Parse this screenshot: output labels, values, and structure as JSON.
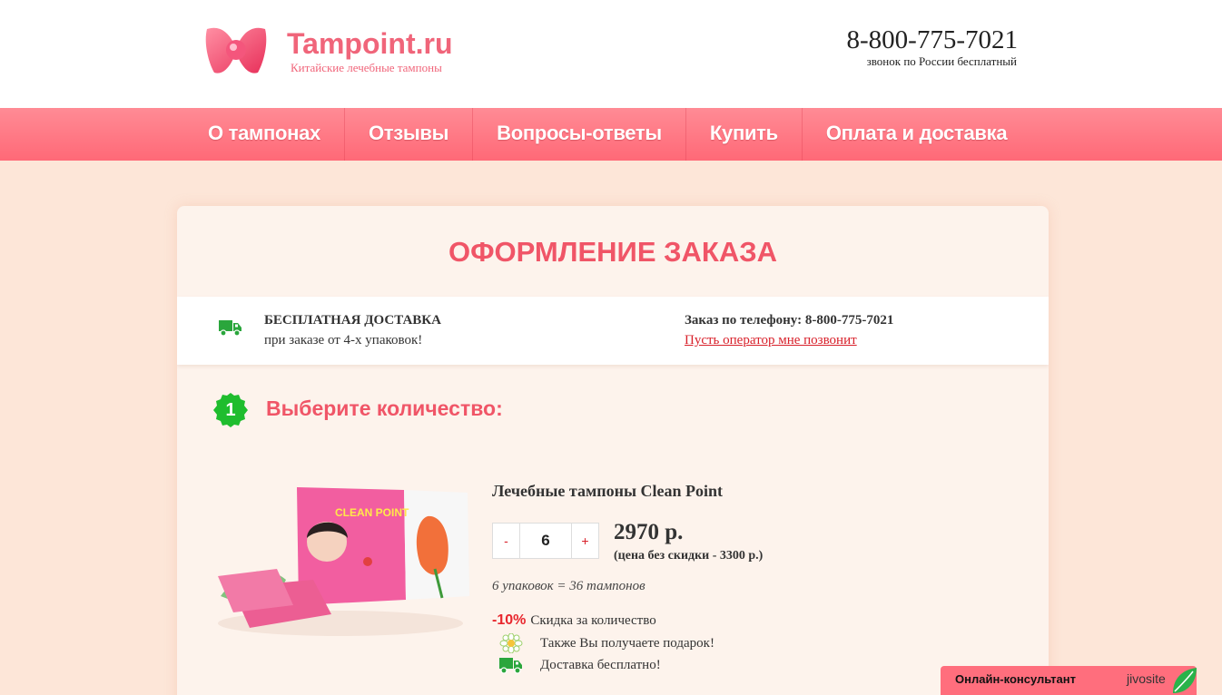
{
  "header": {
    "brand": "Tampoint.ru",
    "tagline": "Китайские лечебные тампоны",
    "phone": "8-800-775-7021",
    "phone_note": "звонок по России бесплатный"
  },
  "nav": {
    "items": [
      {
        "label": "О тампонах"
      },
      {
        "label": "Отзывы"
      },
      {
        "label": "Вопросы-ответы"
      },
      {
        "label": "Купить"
      },
      {
        "label": "Оплата и доставка"
      }
    ]
  },
  "order": {
    "title": "ОФОРМЛЕНИЕ ЗАКАЗА",
    "delivery_title": "БЕСПЛАТНАЯ ДОСТАВКА",
    "delivery_sub": "при заказе от 4-х упаковок!",
    "order_phone": "Заказ по телефону: 8-800-775-7021",
    "callback_link": "Пусть оператор мне позвонит",
    "step_number": "1",
    "step_title": "Выберите количество:",
    "product": {
      "name": "Лечебные тампоны Clean Point",
      "box_text": "CLEAN POINT",
      "minus_label": "-",
      "plus_label": "+",
      "quantity": "6",
      "price": "2970 р.",
      "price_old": "(цена без скидки - 3300 р.)",
      "packs_note": "6 упаковок = 36 тампонов",
      "discount_pct": "-10%",
      "discount_label": "Скидка за количество",
      "gift_label": "Также Вы получаете подарок!",
      "free_delivery_label": "Доставка бесплатно!"
    }
  },
  "chat": {
    "label": "Онлайн-консультант",
    "brand": "jivosite"
  },
  "colors": {
    "accent": "#f05567",
    "nav": "#ff6977",
    "background": "#fde6d8",
    "green": "#2aa63c",
    "link": "#d8202a"
  },
  "icons": [
    "logo-icon",
    "truck-icon",
    "step-badge-icon",
    "flower-icon",
    "leaf-icon"
  ]
}
